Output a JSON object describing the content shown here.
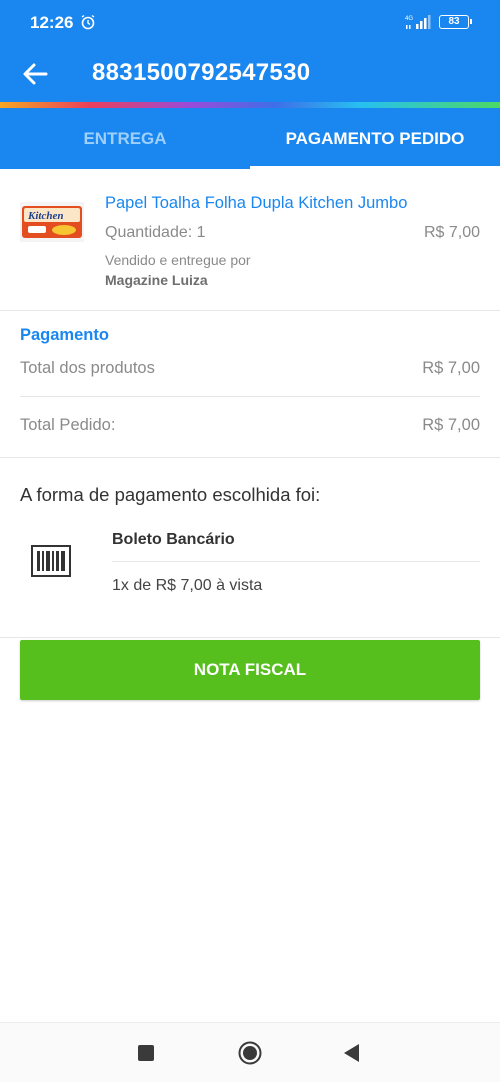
{
  "status_bar": {
    "time": "12:26",
    "network": "4G",
    "battery": "83"
  },
  "header": {
    "title": "8831500792547530"
  },
  "tabs": [
    {
      "label": "ENTREGA",
      "active": false
    },
    {
      "label": "PAGAMENTO PEDIDO",
      "active": true
    }
  ],
  "product": {
    "name": "Papel Toalha Folha Dupla Kitchen Jumbo",
    "quantity": "Quantidade: 1",
    "price": "R$ 7,00",
    "sold_by_label": "Vendido e entregue por",
    "seller": "Magazine Luiza",
    "thumb_brand": "Kitchen"
  },
  "payment": {
    "heading": "Pagamento",
    "rows": [
      {
        "label": "Total dos produtos",
        "value": "R$ 7,00"
      },
      {
        "label": "Total Pedido:",
        "value": "R$ 7,00"
      }
    ]
  },
  "payment_method": {
    "intro": "A forma de pagamento escolhida foi:",
    "name": "Boleto Bancário",
    "installment": "1x de R$ 7,00 à vista",
    "icon": "barcode-icon"
  },
  "actions": {
    "nota_fiscal": "NOTA FISCAL"
  },
  "colors": {
    "primary": "#1a87f0",
    "button_green": "#56bf1d",
    "muted_text": "#8a8a8a"
  }
}
